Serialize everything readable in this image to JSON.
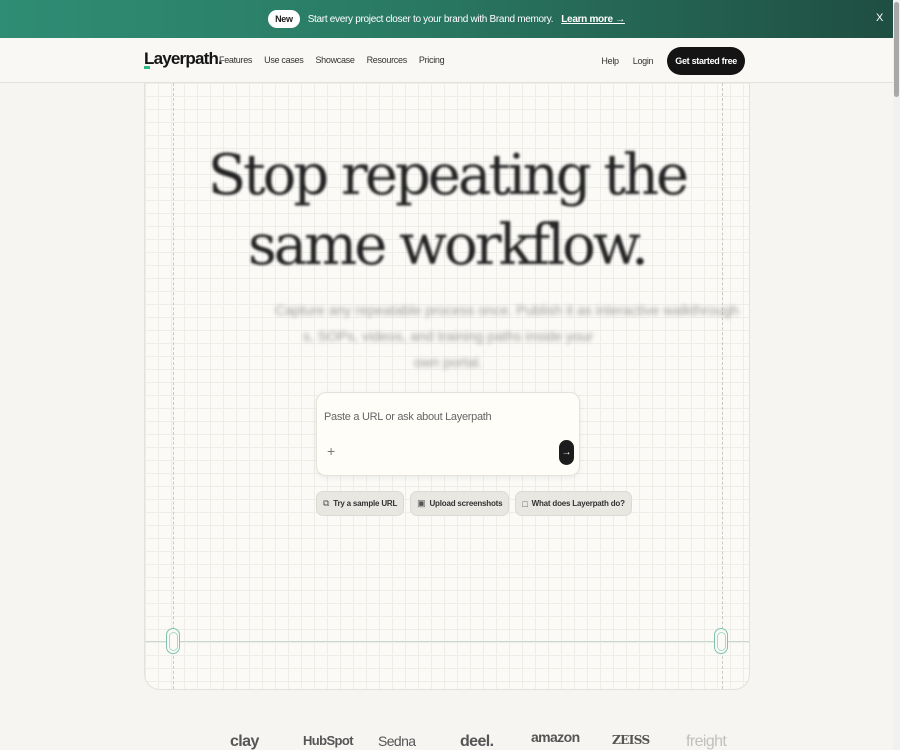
{
  "banner": {
    "badge": "New",
    "message": "Start every project closer to your brand with Brand memory.",
    "link": "Learn more →",
    "close": "X"
  },
  "nav": {
    "logo": "Layerpath.",
    "links": [
      "Features",
      "Use cases",
      "Showcase",
      "Resources",
      "Pricing"
    ],
    "help": "Help",
    "login": "Login",
    "cta": "Get started free"
  },
  "hero": {
    "headline_line1": "Stop repeating the",
    "headline_line2": "same workflow.",
    "subline_line1": "Capture any repeatable process once. Publish it as interactive walkthrough",
    "subline_line2": "s, SOPs, videos, and training paths inside your own portal."
  },
  "prompt": {
    "placeholder": "Paste a URL or ask about Layerpath",
    "plus": "+",
    "send": "→"
  },
  "chips": [
    {
      "icon": "⧉",
      "label": "Try a sample URL",
      "icon_name": "link-icon"
    },
    {
      "icon": "▣",
      "label": "Upload screenshots",
      "icon_name": "image-icon"
    },
    {
      "icon": "□",
      "label": "What does Layerpath do?",
      "icon_name": "chat-icon"
    }
  ],
  "logos": [
    "clay",
    "HubSpot",
    "Sedna",
    "deel.",
    "amazon",
    "ZEISS",
    "freight"
  ],
  "colors": {
    "banner_start": "#2f8d74",
    "banner_end": "#1f4e42",
    "accent": "#2eb88a",
    "cta_bg": "#141414"
  }
}
